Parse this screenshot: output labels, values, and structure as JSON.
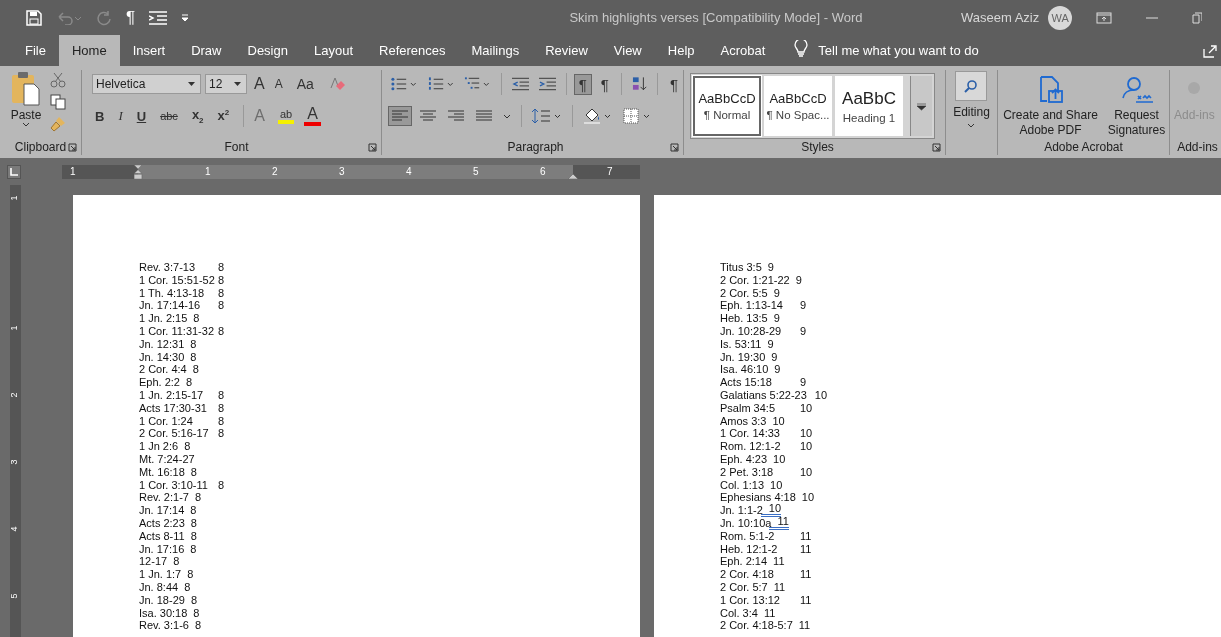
{
  "quick_access": {
    "show_marks": "¶"
  },
  "window": {
    "title": "Skim highlights verses [Compatibility Mode]  -  Word",
    "user": "Waseem Aziz",
    "avatar": "WA"
  },
  "tabs": [
    {
      "label": "File",
      "selected": false
    },
    {
      "label": "Home",
      "selected": true
    },
    {
      "label": "Insert",
      "selected": false
    },
    {
      "label": "Draw",
      "selected": false
    },
    {
      "label": "Design",
      "selected": false
    },
    {
      "label": "Layout",
      "selected": false
    },
    {
      "label": "References",
      "selected": false
    },
    {
      "label": "Mailings",
      "selected": false
    },
    {
      "label": "Review",
      "selected": false
    },
    {
      "label": "View",
      "selected": false
    },
    {
      "label": "Help",
      "selected": false
    },
    {
      "label": "Acrobat",
      "selected": false
    }
  ],
  "tell_me": {
    "placeholder": "Tell me what you want to do"
  },
  "clipboard": {
    "paste": "Paste",
    "label": "Clipboard"
  },
  "font": {
    "name": "Helvetica",
    "size": "12",
    "grow": "A",
    "shrink": "A",
    "change_case": "Aa",
    "format_buttons": [
      "B",
      "I",
      "U",
      "abc"
    ],
    "subscript": "x",
    "subscript_mark": "2",
    "superscript": "x",
    "superscript_mark": "2",
    "text_effects": "A",
    "highlight": "ab",
    "font_color": "A",
    "label": "Font"
  },
  "paragraph": {
    "ltr": "¶",
    "rtl": "¶",
    "ltr_selected": true,
    "rtl_selected": false,
    "show_marks": "¶",
    "alignments": [
      {
        "kind": "left",
        "selected": true
      },
      {
        "kind": "center",
        "selected": false
      },
      {
        "kind": "right",
        "selected": false
      },
      {
        "kind": "justify",
        "selected": false
      }
    ],
    "label": "Paragraph"
  },
  "styles": {
    "items": [
      {
        "preview": "AaBbCcD",
        "name": "¶ Normal",
        "kind": "body",
        "selected": true
      },
      {
        "preview": "AaBbCcD",
        "name": "¶ No Spac...",
        "kind": "body",
        "selected": false
      },
      {
        "preview": "AaBbC",
        "name": "Heading 1",
        "kind": "heading",
        "selected": false
      }
    ],
    "label": "Styles"
  },
  "editing": {
    "label": "Editing"
  },
  "adobe": {
    "buttons": [
      {
        "kind": "pdf",
        "label": "Create and Share Adobe PDF"
      },
      {
        "kind": "sign",
        "label": "Request Signatures"
      }
    ],
    "label": "Adobe Acrobat"
  },
  "addins": {
    "button": "Add-ins",
    "disabled": true,
    "label": "Add-ins"
  },
  "ruler": {
    "numbers": [
      "1",
      "1",
      "2",
      "3",
      "4",
      "5",
      "6",
      "7"
    ]
  },
  "vertical_ruler": {
    "numbers": [
      "1",
      "1",
      "2",
      "3",
      "4",
      "5"
    ]
  },
  "pages": [
    {
      "lines": [
        {
          "ref": "Rev. 3:7-13",
          "number": "8",
          "tab": true
        },
        {
          "ref": "1 Cor. 15:51-52",
          "number": "8",
          "tab": true
        },
        {
          "ref": "1 Th. 4:13-18",
          "number": "8",
          "tab": true
        },
        {
          "ref": "Jn. 17:14-16",
          "number": "8",
          "tab": true
        },
        {
          "ref": "1 Jn. 2:15",
          "number": "8",
          "tab": false
        },
        {
          "ref": "1 Cor. 11:31-32",
          "number": "8",
          "tab": true
        },
        {
          "ref": "Jn. 12:31",
          "number": "8",
          "tab": false
        },
        {
          "ref": "Jn. 14:30",
          "number": "8",
          "tab": false
        },
        {
          "ref": "2 Cor. 4:4",
          "number": "8",
          "tab": false
        },
        {
          "ref": "Eph. 2:2",
          "number": "8",
          "tab": false
        },
        {
          "ref": "1 Jn. 2:15-17",
          "number": "8",
          "tab": true
        },
        {
          "ref": "Acts 17:30-31",
          "number": "8",
          "tab": true
        },
        {
          "ref": "1 Cor. 1:24",
          "number": "8",
          "tab": true
        },
        {
          "ref": "2 Cor. 5:16-17",
          "number": "8",
          "tab": true
        },
        {
          "ref": "1 Jn 2:6",
          "number": "8",
          "tab": false
        },
        {
          "ref": "Mt. 7:24-27",
          "tab": false
        },
        {
          "ref": "Mt. 16:18",
          "number": "8",
          "tab": false
        },
        {
          "ref": "1 Cor. 3:10-11",
          "number": "8",
          "tab": true
        },
        {
          "ref": "Rev. 2:1-7",
          "number": "8",
          "tab": false
        },
        {
          "ref": "Jn. 17:14",
          "number": "8",
          "tab": false
        },
        {
          "ref": "Acts 2:23",
          "number": "8",
          "tab": false
        },
        {
          "ref": "Acts 8-11",
          "number": "8",
          "tab": false
        },
        {
          "ref": "Jn. 17:16",
          "number": "8",
          "tab": false
        },
        {
          "ref": "12-17",
          "number": "8",
          "tab": false
        },
        {
          "ref": "1 Jn. 1:7",
          "number": "8",
          "tab": false
        },
        {
          "ref": "Jn. 8:44",
          "number": "8",
          "tab": false
        },
        {
          "ref": "Jn. 18-29",
          "number": "8",
          "tab": false
        },
        {
          "ref": "Isa. 30:18",
          "number": "8",
          "tab": false
        },
        {
          "ref": "Rev. 3:1-6",
          "number": "8",
          "tab": false
        }
      ]
    },
    {
      "lines": [
        {
          "ref": "Titus 3:5",
          "number": "9",
          "tab": false
        },
        {
          "ref": "2 Cor. 1:21-22",
          "number": "9",
          "tab": false
        },
        {
          "ref": "2 Cor. 5:5",
          "number": "9",
          "tab": false
        },
        {
          "ref": "Eph. 1:13-14",
          "number": "9",
          "tab": true
        },
        {
          "ref": "Heb. 13:5",
          "number": "9",
          "tab": false
        },
        {
          "ref": "Jn. 10:28-29",
          "number": "9",
          "tab": true
        },
        {
          "ref": "Is. 53:11",
          "number": "9",
          "tab": false
        },
        {
          "ref": "Jn. 19:30",
          "number": "9",
          "tab": false
        },
        {
          "ref": "Isa. 46:10",
          "number": "9",
          "tab": false
        },
        {
          "ref": "Acts 15:18",
          "number": "9",
          "tab": true
        },
        {
          "ref": "Galatians 5:22-23",
          "number": "10",
          "tab": true
        },
        {
          "ref": "Psalm 34:5",
          "number": "10",
          "tab": true
        },
        {
          "ref": "Amos 3:3",
          "number": "10",
          "tab": false
        },
        {
          "ref": "1 Cor. 14:33",
          "number": "10",
          "tab": true
        },
        {
          "ref": "Rom. 12:1-2",
          "number": "10",
          "tab": true
        },
        {
          "ref": "Eph. 4:23",
          "number": "10",
          "tab": false
        },
        {
          "ref": "2 Pet. 3:18",
          "number": "10",
          "tab": true
        },
        {
          "ref": "Col. 1:13",
          "number": "10",
          "tab": false
        },
        {
          "ref": "Ephesians 4:18",
          "number": "10",
          "tab": false
        },
        {
          "ref": "Jn. 1:1-2",
          "number": "10",
          "tab": false,
          "flagged": true
        },
        {
          "ref": "Jn. 10:10a",
          "number": "11",
          "tab": false,
          "flagged": true
        },
        {
          "ref": "Rom. 5:1-2",
          "number": "11",
          "tab": true
        },
        {
          "ref": "Heb. 12:1-2",
          "number": "11",
          "tab": true
        },
        {
          "ref": "Eph. 2:14",
          "number": "11",
          "tab": false
        },
        {
          "ref": "2 Cor. 4:18",
          "number": "11",
          "tab": true
        },
        {
          "ref": "2 Cor. 5:7",
          "number": "11",
          "tab": false
        },
        {
          "ref": "1 Cor. 13:12",
          "number": "11",
          "tab": true
        },
        {
          "ref": "Col. 3:4",
          "number": "11",
          "tab": false
        },
        {
          "ref": "2 Cor. 4:18-5:7",
          "number": "11",
          "tab": false
        }
      ]
    }
  ]
}
